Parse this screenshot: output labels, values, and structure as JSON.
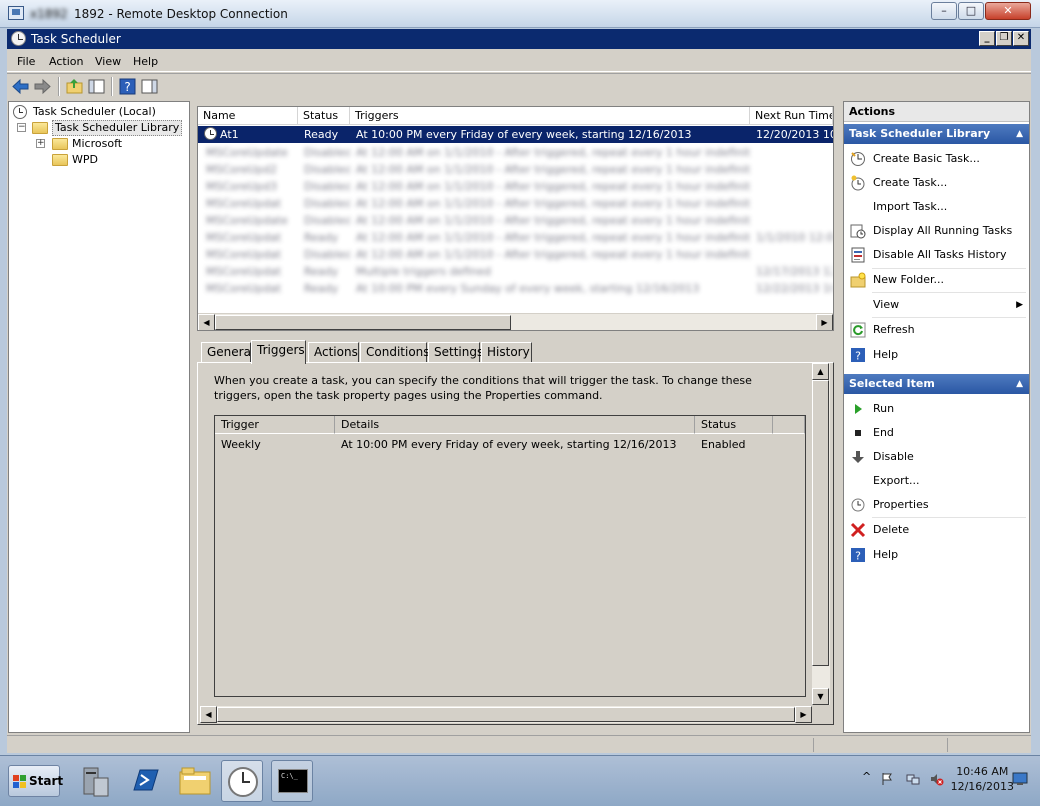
{
  "rdp": {
    "title_blurred": "x1892",
    "title_suffix": "1892 - Remote Desktop Connection",
    "min": "–",
    "max": "□",
    "close": "✕"
  },
  "window": {
    "title": "Task Scheduler",
    "min": "_",
    "max": "❐",
    "close": "✕"
  },
  "menu": [
    "File",
    "Action",
    "View",
    "Help"
  ],
  "tree": {
    "root": "Task Scheduler (Local)",
    "library": "Task Scheduler Library",
    "children": [
      "Microsoft",
      "WPD"
    ],
    "expand_minus": "−",
    "expand_plus": "+"
  },
  "list": {
    "columns": [
      "Name",
      "Status",
      "Triggers",
      "Next Run Time"
    ],
    "selected": {
      "name": "At1",
      "status": "Ready",
      "triggers": "At 10:00 PM every Friday of every week, starting 12/16/2013",
      "next": "12/20/2013 10:"
    },
    "blurred_rows": [
      {
        "name": "MSCoreUpdate",
        "status": "Disabled",
        "triggers": "At 12:00 AM on 1/1/2010 - After triggered, repeat every 1 hour indefinitely",
        "next": ""
      },
      {
        "name": "MSCoreUpd2",
        "status": "Disabled",
        "triggers": "At 12:00 AM on 1/1/2010 - After triggered, repeat every 1 hour indefinitely",
        "next": ""
      },
      {
        "name": "MSCoreUpd3",
        "status": "Disabled",
        "triggers": "At 12:00 AM on 1/1/2010 - After triggered, repeat every 1 hour indefinitely",
        "next": ""
      },
      {
        "name": "MSCoreUpdat",
        "status": "Disabled",
        "triggers": "At 12:00 AM on 1/1/2010 - After triggered, repeat every 1 hour indefinitely",
        "next": ""
      },
      {
        "name": "MSCoreUpdate",
        "status": "Disabled",
        "triggers": "At 12:00 AM on 1/1/2010 - After triggered, repeat every 1 hour indefinitely",
        "next": ""
      },
      {
        "name": "MSCoreUpdat",
        "status": "Ready",
        "triggers": "At 12:00 AM on 1/1/2010 - After triggered, repeat every 1 hour indefinitely",
        "next": "1/1/2010 12:00"
      },
      {
        "name": "MSCoreUpdat",
        "status": "Disabled",
        "triggers": "At 12:00 AM on 1/1/2010 - After triggered, repeat every 1 hour indefinitely",
        "next": ""
      },
      {
        "name": "MSCoreUpdat",
        "status": "Ready",
        "triggers": "Multiple triggers defined",
        "next": "12/17/2013 12"
      },
      {
        "name": "MSCoreUpdat",
        "status": "Ready",
        "triggers": "At 10:00 PM every Sunday of every week, starting 12/16/2013",
        "next": "12/22/2013 10"
      }
    ],
    "left_arrow": "◀",
    "right_arrow": "▶"
  },
  "tabs": [
    "General",
    "Triggers",
    "Actions",
    "Conditions",
    "Settings",
    "History"
  ],
  "triggers_panel": {
    "description": "When you create a task, you can specify the conditions that will trigger the task.  To change these triggers, open the task property pages using the Properties command.",
    "columns": [
      "Trigger",
      "Details",
      "Status"
    ],
    "rows": [
      {
        "trigger": "Weekly",
        "details": "At 10:00 PM every Friday of every week, starting 12/16/2013",
        "status": "Enabled"
      }
    ],
    "up": "▲",
    "down": "▼",
    "left": "◀",
    "right": "▶"
  },
  "actions": {
    "header": "Actions",
    "section1": "Task Scheduler Library",
    "section1_items": [
      "Create Basic Task...",
      "Create Task...",
      "Import Task...",
      "Display All Running Tasks",
      "Disable All Tasks History",
      "New Folder...",
      "View",
      "Refresh",
      "Help"
    ],
    "section2": "Selected Item",
    "section2_items": [
      "Run",
      "End",
      "Disable",
      "Export...",
      "Properties",
      "Delete",
      "Help"
    ],
    "chevron": "▲",
    "submenu_arrow": "▶"
  },
  "taskbar": {
    "start": "Start",
    "time": "10:46 AM",
    "date": "12/16/2013",
    "cmd_text": "C:\\_"
  },
  "colors": {
    "selection": "#0a246a",
    "title": "#0b2a6f",
    "action_header": "#3a66b0"
  }
}
